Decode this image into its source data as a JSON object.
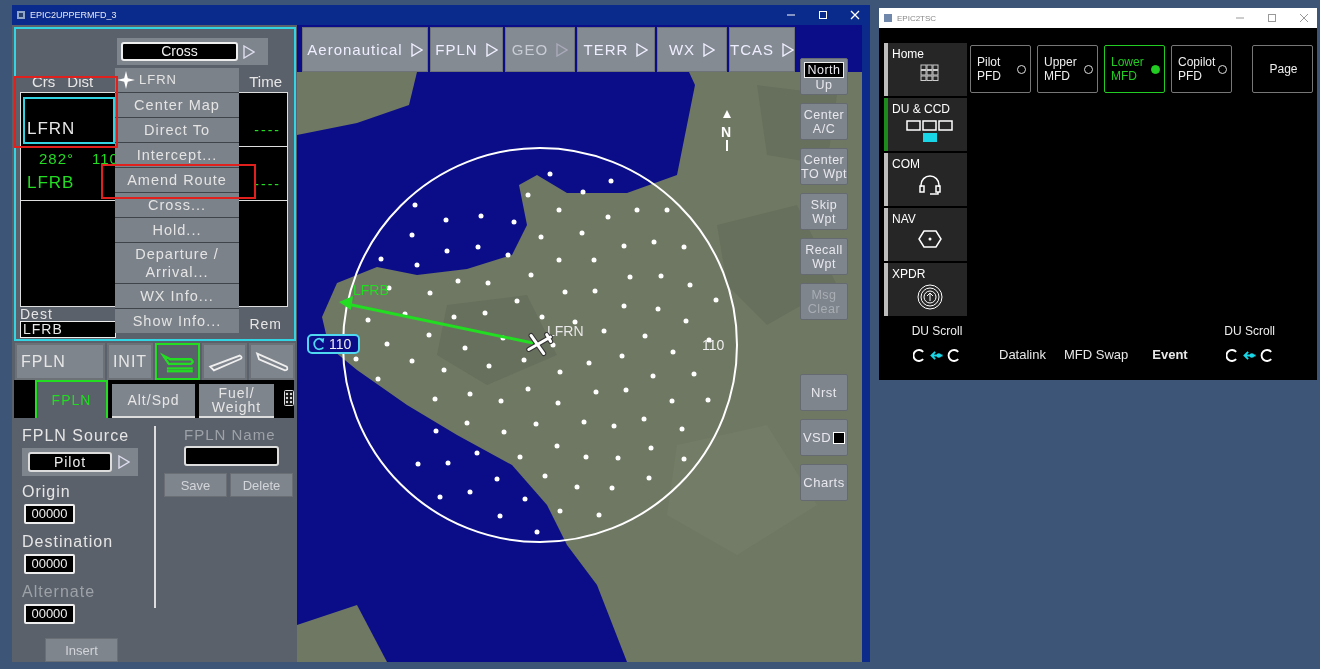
{
  "mfd_window": {
    "title": "EPIC2UPPERMFD_3"
  },
  "fpln_summary": {
    "selector": "Cross",
    "columns": [
      "Crs",
      "Dist",
      "Time"
    ],
    "rows": [
      {
        "waypoint": "LFRN",
        "time": "----",
        "selected": true,
        "annotated": true
      },
      {
        "course": "282°",
        "distance": "110",
        "waypoint": "LFRB",
        "time": "----",
        "selected": false,
        "annotated": false
      }
    ],
    "dest_label": "Dest",
    "dest_value": "LFRB",
    "rem_label": "Rem"
  },
  "context_menu": {
    "items": [
      {
        "label": "LFRN",
        "kind": "header",
        "annotated": false
      },
      {
        "label": "Center Map",
        "kind": "item",
        "annotated": false
      },
      {
        "label": "Direct To",
        "kind": "item",
        "annotated": false
      },
      {
        "label": "Intercept...",
        "kind": "item",
        "annotated": false
      },
      {
        "label": "Amend Route",
        "kind": "item",
        "annotated": true
      },
      {
        "label": "Cross...",
        "kind": "item",
        "annotated": false
      },
      {
        "label": "Hold...",
        "kind": "item",
        "annotated": false
      },
      {
        "label": "Departure /\nArrival...",
        "kind": "item",
        "annotated": false
      },
      {
        "label": "WX Info...",
        "kind": "item",
        "annotated": false
      },
      {
        "label": "Show Info...",
        "kind": "item",
        "annotated": false
      }
    ]
  },
  "page_tabs": [
    {
      "label": "FPLN",
      "kind": "text",
      "selected": false
    },
    {
      "label": "INIT",
      "kind": "text",
      "selected": false
    },
    {
      "kind": "taxi",
      "selected": true
    },
    {
      "kind": "climb",
      "selected": false
    },
    {
      "kind": "descent",
      "selected": false
    }
  ],
  "sub_tabs": [
    {
      "label": "FPLN",
      "selected": true
    },
    {
      "label": "Alt/Spd",
      "selected": false
    },
    {
      "label": "Fuel/\nWeight",
      "selected": false
    }
  ],
  "fpln_form": {
    "source_label": "FPLN Source",
    "source_value": "Pilot",
    "fields": [
      {
        "label": "Origin",
        "value": "00000",
        "disabled": false
      },
      {
        "label": "Destination",
        "value": "00000",
        "disabled": false
      },
      {
        "label": "Alternate",
        "value": "00000",
        "disabled": true
      }
    ],
    "insert": {
      "label": "Insert",
      "disabled": true
    },
    "name_label": "FPLN Name",
    "name_disabled": true,
    "actions": [
      {
        "label": "Save",
        "disabled": true
      },
      {
        "label": "Delete",
        "disabled": true
      }
    ]
  },
  "map_menu": [
    {
      "label": "Aeronautical",
      "disabled": false
    },
    {
      "label": "FPLN",
      "disabled": false
    },
    {
      "label": "GEO",
      "disabled": true
    },
    {
      "label": "TERR",
      "disabled": false
    },
    {
      "label": "WX",
      "disabled": false
    },
    {
      "label": "TCAS",
      "disabled": false
    }
  ],
  "map_buttons_top": [
    {
      "label": "North",
      "label2": "Up",
      "kind": "toggle",
      "active": true,
      "disabled": false
    },
    {
      "label": "Center\nA/C",
      "kind": "plain",
      "disabled": false
    },
    {
      "label": "Center\nTO Wpt",
      "kind": "plain",
      "disabled": false
    },
    {
      "label": "Skip\nWpt",
      "kind": "plain",
      "disabled": false
    },
    {
      "label": "Recall\nWpt",
      "kind": "plain",
      "disabled": false
    },
    {
      "label": "Msg\nClear",
      "kind": "plain",
      "disabled": true
    }
  ],
  "map_buttons_bottom": [
    {
      "label": "Nrst",
      "kind": "plain",
      "disabled": false
    },
    {
      "label": "VSD",
      "kind": "checkbox",
      "checked": false,
      "disabled": false
    },
    {
      "label": "Charts",
      "kind": "plain",
      "disabled": false
    }
  ],
  "map": {
    "north_label": "N",
    "range_ring_label": "110",
    "range_badge": "110",
    "route_label": "LFRB",
    "aircraft_label": "LFRN"
  },
  "tsc_window": {
    "title": "EPIC2TSC"
  },
  "tsc_sidebar": [
    {
      "label": "Home",
      "kind": "home",
      "selected": false
    },
    {
      "label": "DU & CCD",
      "kind": "display",
      "selected": true
    },
    {
      "label": "COM",
      "kind": "com",
      "selected": false
    },
    {
      "label": "NAV",
      "kind": "nav",
      "selected": false
    },
    {
      "label": "XPDR",
      "kind": "xpdr",
      "selected": false
    }
  ],
  "tsc_targets": [
    {
      "label": "Pilot\nPFD",
      "kind": "radio",
      "selected": false
    },
    {
      "label": "Upper\nMFD",
      "kind": "radio",
      "selected": false
    },
    {
      "label": "Lower\nMFD",
      "kind": "radio",
      "selected": true
    },
    {
      "label": "Copilot\nPFD",
      "kind": "radio",
      "selected": false
    },
    {
      "label": "Page",
      "kind": "plain",
      "selected": false
    }
  ],
  "tsc_footer": {
    "left_scroll": "DU Scroll",
    "right_scroll": "DU Scroll",
    "buttons": [
      {
        "label": "Datalink",
        "selected": false
      },
      {
        "label": "MFD Swap",
        "selected": false
      },
      {
        "label": "Event",
        "selected": true
      }
    ]
  }
}
